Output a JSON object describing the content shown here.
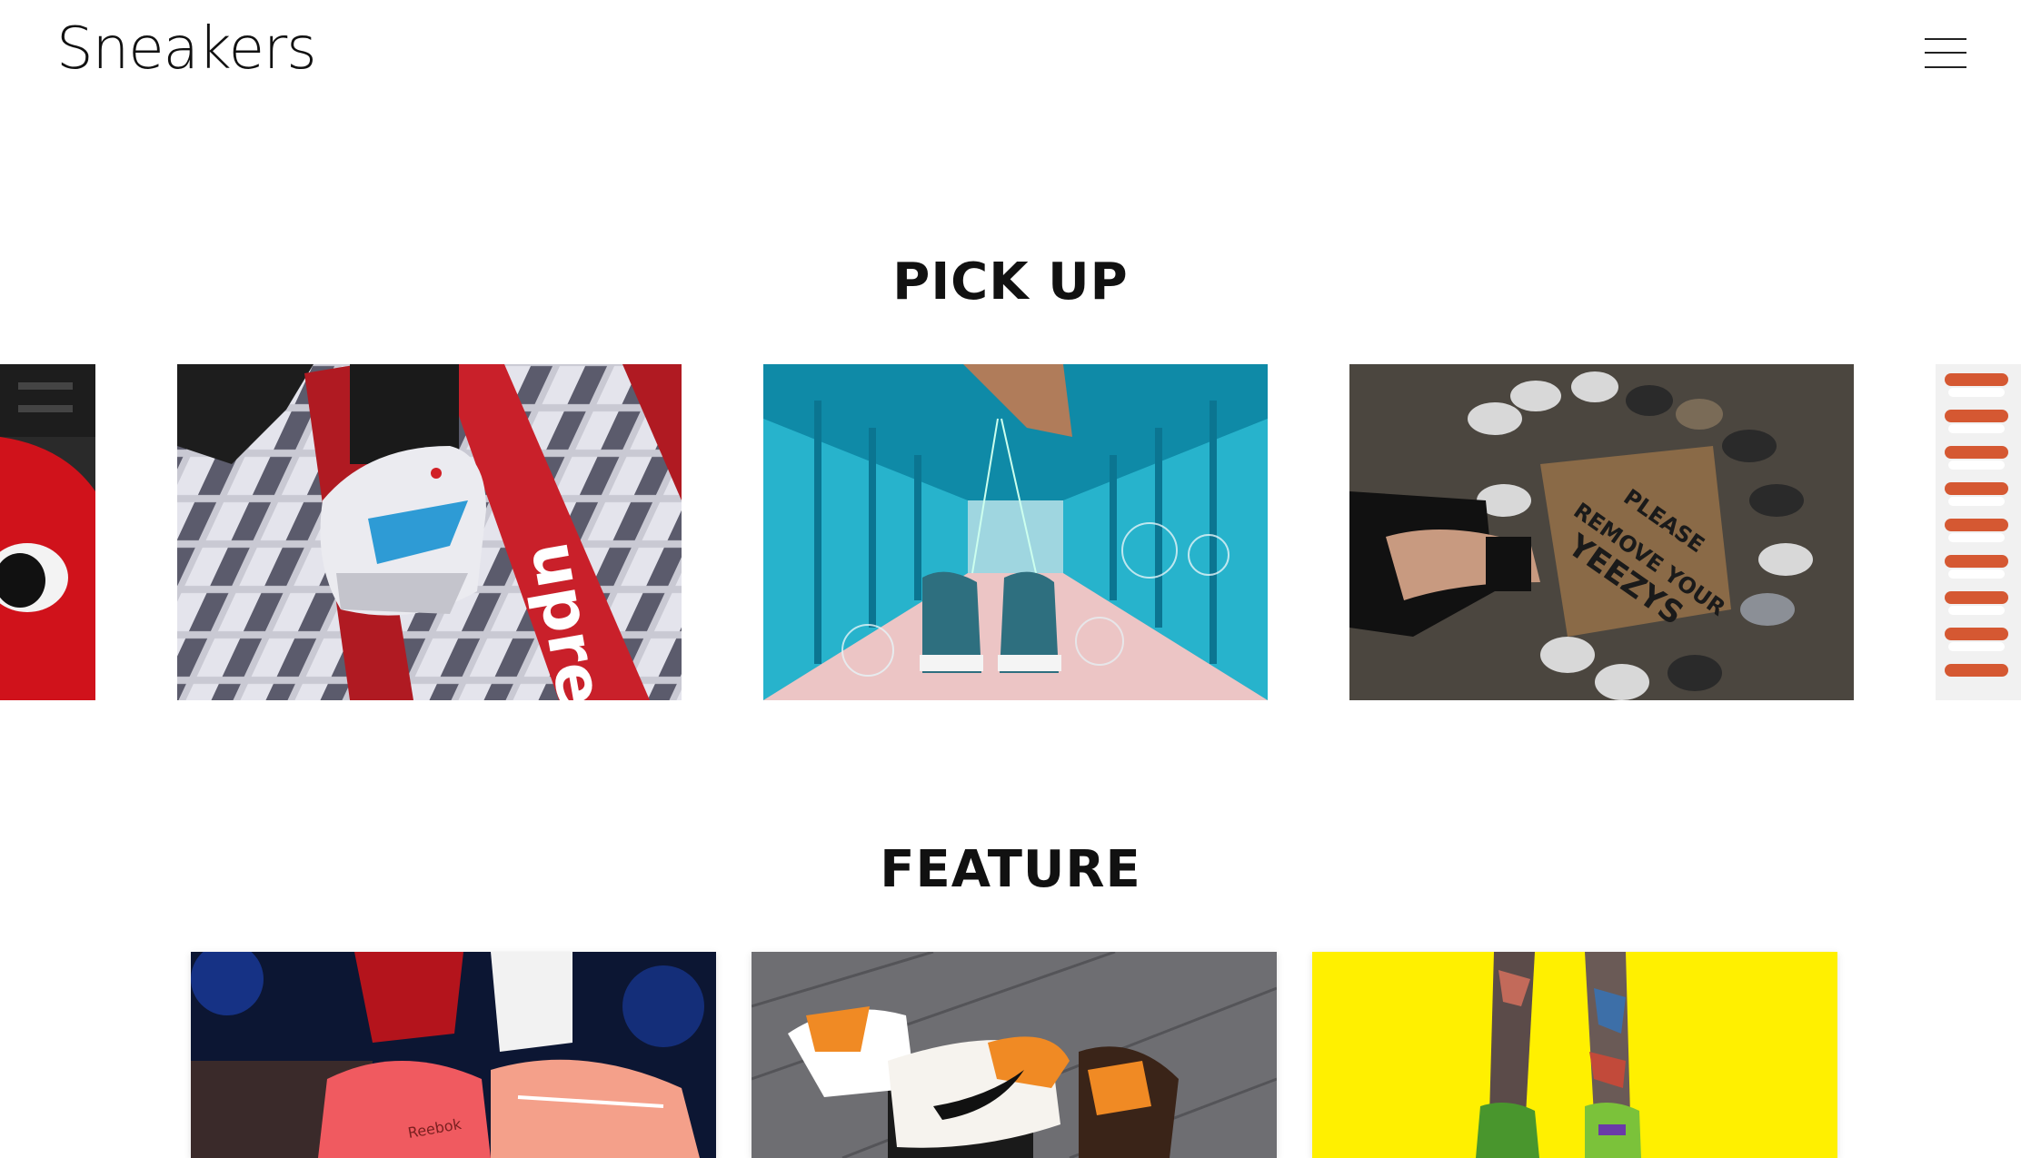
{
  "header": {
    "logo": "Sneakers",
    "menu_icon": "hamburger-menu-icon"
  },
  "pickup": {
    "title": "PICK UP",
    "slides": [
      {
        "name": "slide-red-character"
      },
      {
        "name": "slide-supreme-sneaker"
      },
      {
        "name": "slide-sneakers-bubbles-bridge"
      },
      {
        "name": "slide-yeezys-doormat",
        "doormat_text": [
          "PLEASE",
          "REMOVE YOUR",
          "YEEZYS"
        ]
      },
      {
        "name": "slide-sneaker-rows"
      }
    ]
  },
  "feature": {
    "title": "FEATURE",
    "cards": [
      {
        "name": "card-red-sneakers"
      },
      {
        "name": "card-orange-jordans"
      },
      {
        "name": "card-yellow-legs"
      }
    ]
  },
  "colors": {
    "text": "#111111",
    "background": "#ffffff"
  }
}
